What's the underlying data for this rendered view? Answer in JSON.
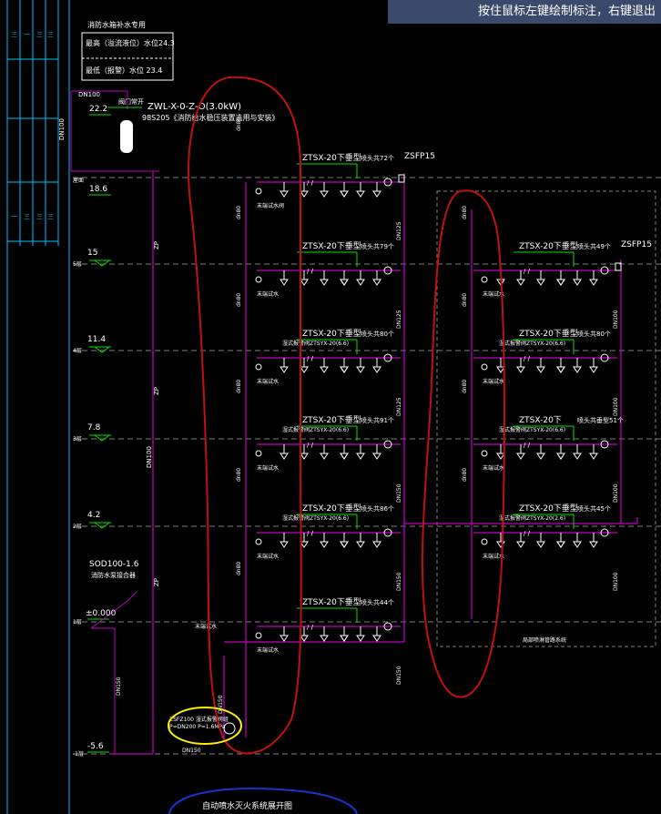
{
  "command_hint": "按住鼠标左键绘制标注，右键退出",
  "tank": {
    "title": "消防水箱补水专用",
    "max_level": "最高（溢流液位）水位24.3",
    "min_level": "最低（报警）水位 23.4",
    "outlet_pipe": "DN100",
    "elev": "22.2",
    "valve_note": "阀门常开"
  },
  "pump": {
    "model": "ZWL-X-0-Z-O(3.0kW)",
    "note": "98S205《消防给水稳压装置选用与安装》",
    "elev": "18.6",
    "label": "屋面"
  },
  "floors": [
    {
      "elev": "15",
      "label": "5层"
    },
    {
      "elev": "11.4",
      "label": "4层"
    },
    {
      "elev": "7.8",
      "label": "3层"
    },
    {
      "elev": "4.2",
      "label": "2层"
    },
    {
      "elev": "±0.000",
      "label": "1层"
    },
    {
      "elev": "-5.6",
      "label": "-1层"
    }
  ],
  "left_system": {
    "branches": [
      {
        "model": "ZTSX-20下垂型",
        "count": "喷头共72个",
        "sub": "",
        "end": "末端试水阀"
      },
      {
        "model": "ZTSX-20下垂型",
        "count": "喷头共79个",
        "sub": "",
        "end": "末端试水"
      },
      {
        "model": "ZTSX-20下垂型",
        "count": "喷头共80个",
        "sub": "湿式报警阀ZTSYX-20(6.6)",
        "end": "末端试水"
      },
      {
        "model": "ZTSX-20下垂型",
        "count": "喷头共91个",
        "sub": "湿式报警阀ZTSYX-20(6.6)",
        "end": "末端试水"
      },
      {
        "model": "ZTSX-20下垂型",
        "count": "喷头共86个",
        "sub": "湿式报警阀ZTSYX-20(6.6)",
        "end": "末端试水"
      },
      {
        "model": "ZTSX-20下垂型",
        "count": "喷头共44个",
        "sub": "",
        "end": "末端试水"
      }
    ],
    "pipe_labels": [
      "DN125",
      "DN125",
      "DN125",
      "DN150",
      "DN150",
      "DN150"
    ],
    "riser": "dn80",
    "zsfp": "ZSFP15"
  },
  "right_system": {
    "branches": [
      {
        "model": "ZTSX-20下垂型",
        "count": "喷头共49个",
        "sub": "",
        "end": "末端试水"
      },
      {
        "model": "ZTSX-20下垂型",
        "count": "喷头共80个",
        "sub": "湿式报警阀ZTSYX-20(6.6)",
        "end": "末端试水"
      },
      {
        "model": "ZTSX-20下",
        "count": "喷头共垂型51个",
        "sub": "湿式报警阀ZTSYX-20(6.6)",
        "end": "末端试水"
      },
      {
        "model": "ZTSX-20下垂型",
        "count": "喷头共45个",
        "sub": "湿式报警阀ZTSYX-20(2.6)",
        "end": "末端试水"
      }
    ],
    "pipe_labels": [
      "DN100",
      "DN100",
      "DN100",
      "DN100"
    ],
    "zsfp": "ZSFP15",
    "bottom_note": "局部喷淋管路系统"
  },
  "main_riser": "DN100",
  "zp": "ZP",
  "inlet": {
    "pipe": "SOD100-1.6",
    "note": "消防水泵接合器",
    "dn": "DN150"
  },
  "alarm": {
    "model": "ZSFZ100 湿式报警阀组",
    "note": "P=DN200 P=1.6MPa",
    "dn": "DN150",
    "end": "末端试水"
  },
  "title_block": "自动喷水灭火系统展开图",
  "colors": {
    "pipe": "#c000c0",
    "green": "#00e000",
    "white": "#ffffff",
    "cyan": "#00bfff",
    "red": "#c01010",
    "yellow": "#ffee00",
    "blue": "#1a33cc",
    "dash": "#808080"
  }
}
